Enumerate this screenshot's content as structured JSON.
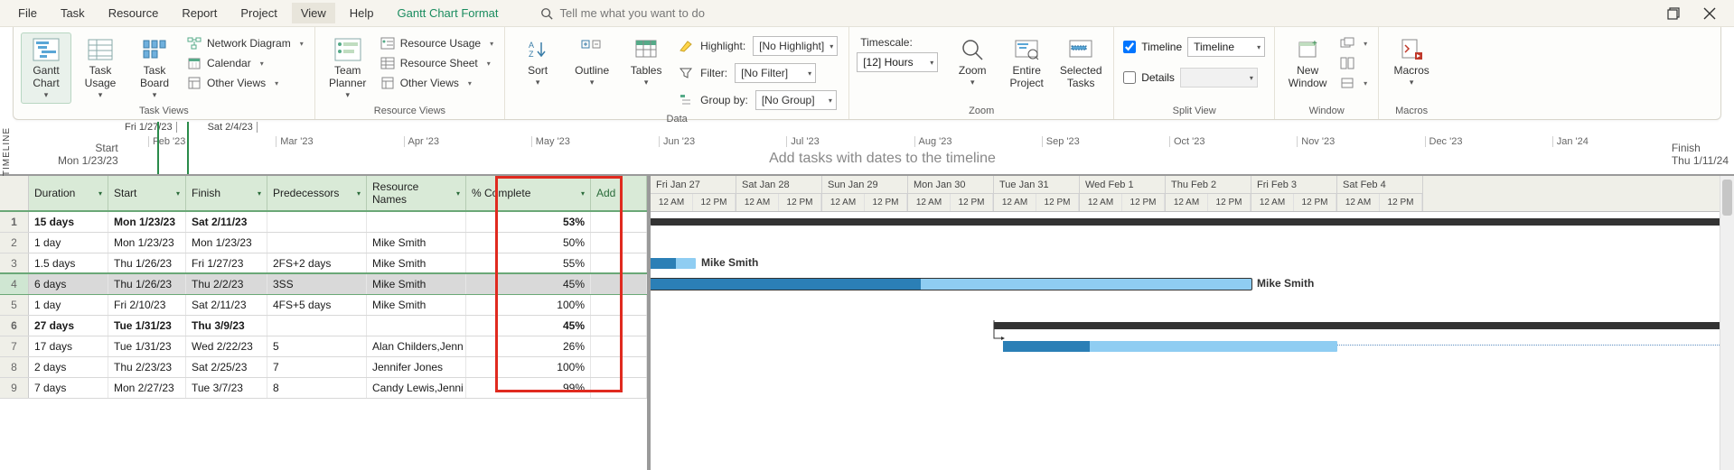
{
  "menu": {
    "items": [
      "File",
      "Task",
      "Resource",
      "Report",
      "Project",
      "View",
      "Help",
      "Gantt Chart Format"
    ],
    "active_index": 5,
    "search_placeholder": "Tell me what you want to do"
  },
  "ribbon": {
    "task_views": {
      "label": "Task Views",
      "gantt_chart": "Gantt\nChart",
      "task_usage": "Task\nUsage",
      "task_board": "Task\nBoard",
      "network_diagram": "Network Diagram",
      "calendar": "Calendar",
      "other_views": "Other Views"
    },
    "resource_views": {
      "label": "Resource Views",
      "team_planner": "Team\nPlanner",
      "resource_usage": "Resource Usage",
      "resource_sheet": "Resource Sheet",
      "other_views": "Other Views"
    },
    "data": {
      "label": "Data",
      "sort": "Sort",
      "outline": "Outline",
      "tables": "Tables",
      "highlight": "Highlight:",
      "highlight_value": "[No Highlight]",
      "filter": "Filter:",
      "filter_value": "[No Filter]",
      "groupby": "Group by:",
      "groupby_value": "[No Group]"
    },
    "zoom": {
      "label": "Zoom",
      "timescale": "Timescale:",
      "timescale_value": "[12] Hours",
      "zoom": "Zoom",
      "entire_project": "Entire\nProject",
      "selected_tasks": "Selected\nTasks"
    },
    "split_view": {
      "label": "Split View",
      "timeline": "Timeline",
      "timeline_value": "Timeline",
      "details": "Details"
    },
    "window": {
      "label": "Window",
      "new_window": "New\nWindow"
    },
    "macros": {
      "label": "Macros",
      "macros": "Macros"
    }
  },
  "timeline": {
    "side_label": "TIMELINE",
    "marker1": "Fri 1/27/23",
    "marker2": "Sat 2/4/23",
    "start_label": "Start",
    "start_date": "Mon 1/23/23",
    "finish_label": "Finish",
    "finish_date": "Thu 1/11/24",
    "months": [
      "Feb '23",
      "Mar '23",
      "Apr '23",
      "May '23",
      "Jun '23",
      "Jul '23",
      "Aug '23",
      "Sep '23",
      "Oct '23",
      "Nov '23",
      "Dec '23",
      "Jan '24"
    ],
    "hint": "Add tasks with dates to the timeline"
  },
  "table": {
    "headers": {
      "duration": "Duration",
      "start": "Start",
      "finish": "Finish",
      "predecessors": "Predecessors",
      "resource_names": "Resource\nNames",
      "pct_complete": "% Complete",
      "add": "Add"
    },
    "rows": [
      {
        "n": "1",
        "dur": "15 days",
        "start": "Mon 1/23/23",
        "finish": "Sat 2/11/23",
        "pred": "",
        "res": "",
        "pct": "53%",
        "summary": true
      },
      {
        "n": "2",
        "dur": "1 day",
        "start": "Mon 1/23/23",
        "finish": "Mon 1/23/23",
        "pred": "",
        "res": "Mike Smith",
        "pct": "50%"
      },
      {
        "n": "3",
        "dur": "1.5 days",
        "start": "Thu 1/26/23",
        "finish": "Fri 1/27/23",
        "pred": "2FS+2 days",
        "res": "Mike Smith",
        "pct": "55%"
      },
      {
        "n": "4",
        "dur": "6 days",
        "start": "Thu 1/26/23",
        "finish": "Thu 2/2/23",
        "pred": "3SS",
        "res": "Mike Smith",
        "pct": "45%",
        "selected": true
      },
      {
        "n": "5",
        "dur": "1 day",
        "start": "Fri 2/10/23",
        "finish": "Sat 2/11/23",
        "pred": "4FS+5 days",
        "res": "Mike Smith",
        "pct": "100%"
      },
      {
        "n": "6",
        "dur": "27 days",
        "start": "Tue 1/31/23",
        "finish": "Thu 3/9/23",
        "pred": "",
        "res": "",
        "pct": "45%",
        "summary": true
      },
      {
        "n": "7",
        "dur": "17 days",
        "start": "Tue 1/31/23",
        "finish": "Wed 2/22/23",
        "pred": "5",
        "res": "Alan Childers,Jenn",
        "pct": "26%"
      },
      {
        "n": "8",
        "dur": "2 days",
        "start": "Thu 2/23/23",
        "finish": "Sat 2/25/23",
        "pred": "7",
        "res": "Jennifer Jones",
        "pct": "100%"
      },
      {
        "n": "9",
        "dur": "7 days",
        "start": "Mon 2/27/23",
        "finish": "Tue 3/7/23",
        "pred": "8",
        "res": "Candy Lewis,Jenni",
        "pct": "99%"
      }
    ]
  },
  "gantt": {
    "days": [
      "Fri Jan 27",
      "Sat Jan 28",
      "Sun Jan 29",
      "Mon Jan 30",
      "Tue Jan 31",
      "Wed Feb 1",
      "Thu Feb 2",
      "Fri Feb 3",
      "Sat Feb 4"
    ],
    "subticks": [
      "12 AM",
      "12 PM"
    ],
    "bar_labels": {
      "row3": "Mike Smith",
      "row4": "Mike Smith"
    }
  }
}
